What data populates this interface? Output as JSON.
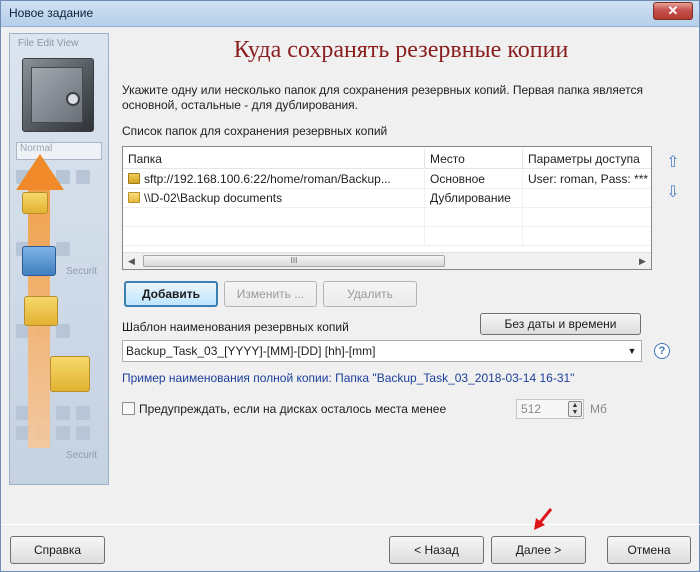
{
  "window": {
    "title": "Новое задание",
    "close_glyph": "✕"
  },
  "sidebar": {
    "menu_text": "File  Edit  View",
    "combo_text": "Normal",
    "ghost_label": "Securit"
  },
  "page": {
    "heading": "Куда сохранять резервные копии",
    "description": "Укажите одну или несколько папок для сохранения резервных копий. Первая папка является основной, остальные - для дублирования.",
    "list_label": "Список папок для сохранения резервных копий"
  },
  "folders_table": {
    "columns": [
      "Папка",
      "Место",
      "Параметры доступа"
    ],
    "rows": [
      {
        "folder": "sftp://192.168.100.6:22/home/roman/Backup...",
        "place": "Основное",
        "access": "User: roman, Pass: ***",
        "icon": "lock-folder-icon"
      },
      {
        "folder": "\\\\D-02\\Backup documents",
        "place": "Дублирование",
        "access": "",
        "icon": "folder-icon"
      }
    ],
    "scroll_thumb_glyph": "III"
  },
  "list_buttons": {
    "add": "Добавить",
    "edit": "Изменить ...",
    "delete": "Удалить"
  },
  "move_buttons": {
    "up": "⇧",
    "down": "⇩"
  },
  "template": {
    "label": "Шаблон наименования резервных копий",
    "no_date_button": "Без даты и времени",
    "value": "Backup_Task_03_[YYYY]-[MM]-[DD] [hh]-[mm]",
    "help": "?",
    "example": "Пример наименования полной копии: Папка \"Backup_Task_03_2018-03-14 16-31\""
  },
  "warn": {
    "label": "Предупреждать, если на дисках осталось места менее",
    "value": "512",
    "unit": "Мб",
    "checked": false
  },
  "footer": {
    "help": "Справка",
    "back": "< Назад",
    "next": "Далее >",
    "cancel": "Отмена"
  },
  "colors": {
    "heading": "#8a1e1e",
    "example_link": "#1c3f9a",
    "annotation_arrow": "#e0141b"
  }
}
